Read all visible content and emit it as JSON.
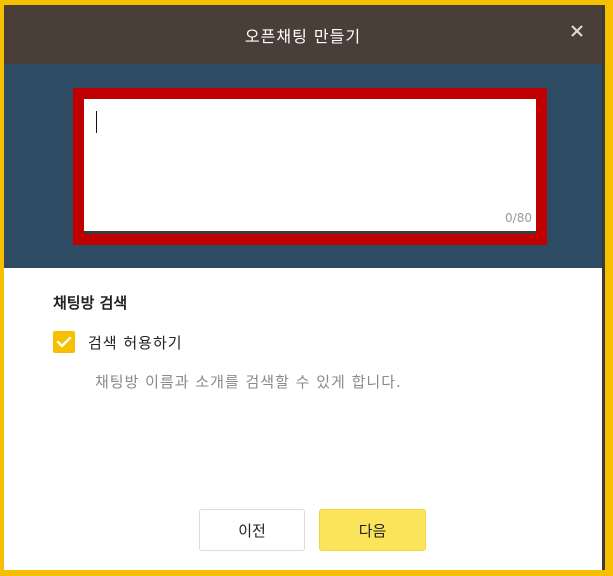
{
  "dialog": {
    "title": "오픈채팅 만들기",
    "close_icon": "close-icon"
  },
  "name_input": {
    "value": "",
    "counter": "0/80"
  },
  "search_section": {
    "title": "채팅방 검색",
    "checkbox_label": "검색 허용하기",
    "checked": true,
    "help_text": "채팅방 이름과 소개를 검색할 수 있게 합니다."
  },
  "buttons": {
    "prev_label": "이전",
    "next_label": "다음"
  },
  "colors": {
    "accent": "#f6c000",
    "titlebar": "#4a3e38",
    "header": "#2d4b63",
    "highlight": "#c00000",
    "next_button": "#fbe35a"
  }
}
